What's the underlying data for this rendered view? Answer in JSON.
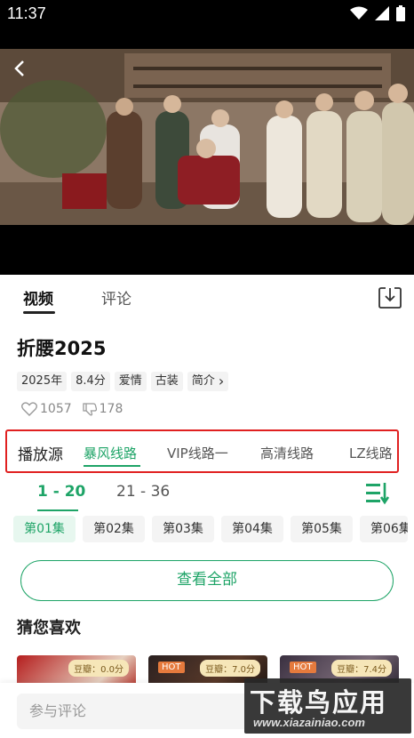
{
  "status_bar": {
    "time": "11:37",
    "wifi_icon": "wifi-icon",
    "signal_icon": "signal-icon",
    "battery_icon": "battery-icon"
  },
  "player": {
    "back_icon": "back-arrow-icon"
  },
  "tabs": {
    "video": "视频",
    "comment": "评论",
    "download_icon": "download-icon"
  },
  "show": {
    "title": "折腰2025",
    "tags": [
      "2025年",
      "8.4分",
      "爱情",
      "古装"
    ],
    "intro": "简介",
    "likes": "1057",
    "dislikes": "178"
  },
  "source": {
    "label": "播放源",
    "items": [
      "暴风线路",
      "VIP线路一",
      "高清线路",
      "LZ线路"
    ],
    "active": "暴风线路"
  },
  "ranges": [
    "1 - 20",
    "21 - 36"
  ],
  "episodes": [
    "第01集",
    "第02集",
    "第03集",
    "第04集",
    "第05集",
    "第06集"
  ],
  "view_all": "查看全部",
  "guess": {
    "title": "猜您喜欢",
    "cards": [
      {
        "hot": "",
        "score": "豆瓣：0.0分"
      },
      {
        "hot": "HOT",
        "score": "豆瓣：7.0分"
      },
      {
        "hot": "HOT",
        "score": "豆瓣：7.4分"
      }
    ]
  },
  "comment_placeholder": "参与评论",
  "watermark": {
    "big": "下载鸟应用",
    "small": "www.xiazainiao.com"
  },
  "colors": {
    "accent": "#1ea467",
    "highlight_border": "#e02020"
  }
}
